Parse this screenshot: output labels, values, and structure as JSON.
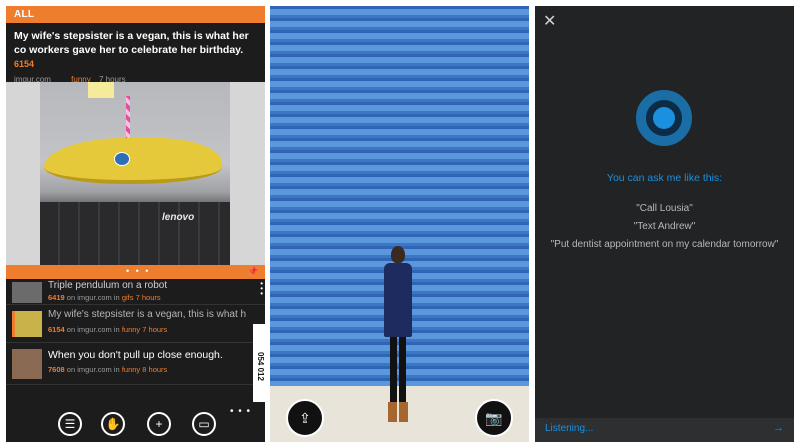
{
  "reader": {
    "section": "ALL",
    "post": {
      "title": "My wife's stepsister is a vegan, this is what her co workers gave her to celebrate her birthday.",
      "score": "6154",
      "domain": "imgur.com",
      "category": "funny",
      "time": "7 hours"
    },
    "image_brand": "lenovo",
    "pager_dots": "• • •",
    "list": [
      {
        "title": "Triple pendulum on a robot",
        "score": "6419",
        "meta": "on imgur.com in",
        "category": "gifs",
        "time": "7 hours"
      },
      {
        "title": "My wife's stepsister is a vegan, this is what her co",
        "score": "6154",
        "meta": "on imgur.com in",
        "category": "funny",
        "time": "7 hours"
      },
      {
        "title": "When you don't pull up close enough.",
        "score": "7608",
        "meta": "on imgur.com in",
        "category": "funny",
        "time": "8 hours"
      }
    ],
    "counter": "054 012",
    "toolbar_more": "• • •"
  },
  "camera": {
    "share_icon": "share-icon",
    "camera_icon": "camera-icon"
  },
  "assistant": {
    "hint": "You can ask me like this:",
    "examples": [
      "\"Call Lousia\"",
      "\"Text Andrew\"",
      "\"Put dentist appointment on my calendar tomorrow\""
    ],
    "status": "Listening...",
    "accent": "#1b90df"
  }
}
